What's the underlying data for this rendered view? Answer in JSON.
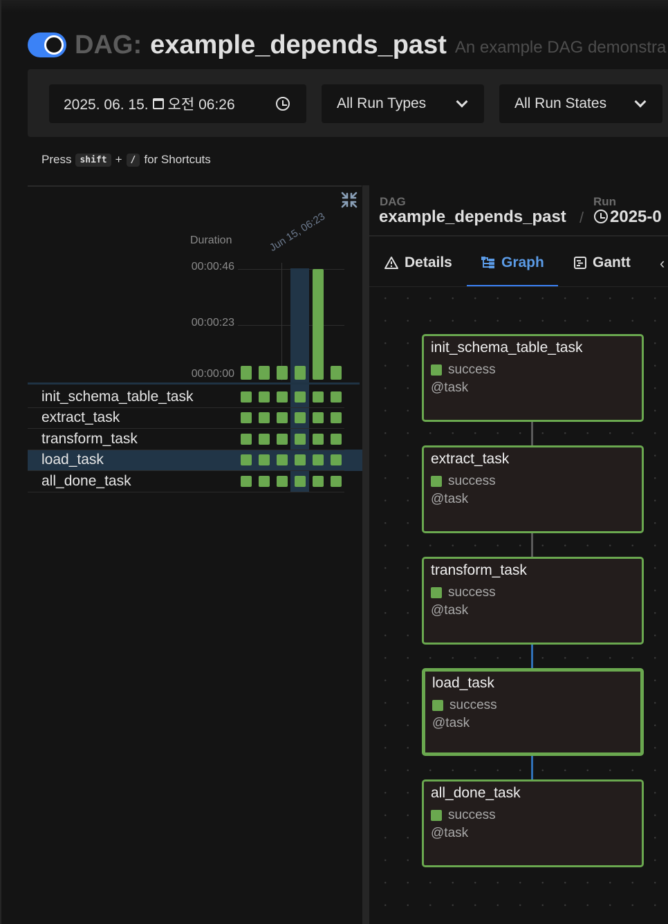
{
  "header": {
    "title_prefix": "DAG:",
    "dag_id": "example_depends_past",
    "description": "An example DAG demonstra"
  },
  "filters": {
    "date_value": "2025. 06. 15.",
    "time_value": "오전 06:26",
    "run_type": "All Run Types",
    "run_state": "All Run States"
  },
  "shortcuts": {
    "press": "Press",
    "key1": "shift",
    "plus": "+",
    "key2": "/",
    "suffix": "for Shortcuts"
  },
  "grid": {
    "duration_label": "Duration",
    "y_ticks": [
      "00:00:46",
      "00:00:23",
      "00:00:00"
    ],
    "run_date_label": "Jun 15, 06:23",
    "run_durations_sec": [
      0,
      0,
      0,
      0,
      46,
      0
    ],
    "tasks": [
      "init_schema_table_task",
      "extract_task",
      "transform_task",
      "load_task",
      "all_done_task"
    ],
    "selected_task": "load_task",
    "selected_run_index": 3
  },
  "breadcrumb": {
    "dag_label": "DAG",
    "dag_value": "example_depends_past",
    "separator": "/",
    "run_label": "Run",
    "run_value": "2025-0"
  },
  "tabs": [
    {
      "label": "Details",
      "icon": "warning-icon"
    },
    {
      "label": "Graph",
      "icon": "graph-icon"
    },
    {
      "label": "Gantt",
      "icon": "gantt-icon"
    }
  ],
  "graph": {
    "nodes": [
      {
        "name": "init_schema_table_task",
        "state": "success",
        "type": "@task"
      },
      {
        "name": "extract_task",
        "state": "success",
        "type": "@task"
      },
      {
        "name": "transform_task",
        "state": "success",
        "type": "@task"
      },
      {
        "name": "load_task",
        "state": "success",
        "type": "@task"
      },
      {
        "name": "all_done_task",
        "state": "success",
        "type": "@task"
      }
    ]
  },
  "colors": {
    "success": "#6aa84f",
    "accent": "#3b82f6",
    "selection": "#213547"
  }
}
